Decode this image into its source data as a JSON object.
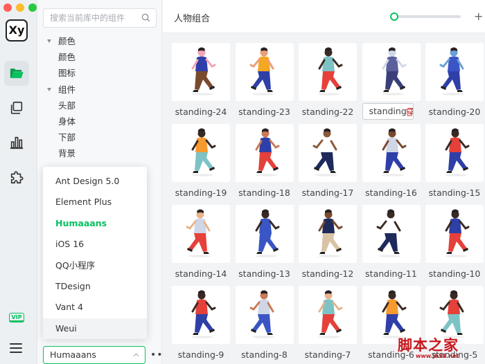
{
  "colors": {
    "accent": "#07c160",
    "traffic_red": "#ff5f57",
    "traffic_yellow": "#febc2e",
    "traffic_green": "#28c840",
    "watermark": "#c6171c"
  },
  "app": {
    "logo_text": "Xy"
  },
  "rail": {
    "items": [
      {
        "icon": "folder-open-icon",
        "active": true
      },
      {
        "icon": "copy-icon",
        "active": false
      },
      {
        "icon": "bar-chart-icon",
        "active": false
      },
      {
        "icon": "puzzle-icon",
        "active": false
      }
    ],
    "vip_label": "VIP",
    "menu_icon": "hamburger-menu-icon"
  },
  "sidebar": {
    "search_placeholder": "搜索当前库中的组件",
    "tree": [
      {
        "label": "颜色",
        "kind": "group"
      },
      {
        "label": "颜色",
        "kind": "leaf"
      },
      {
        "label": "图标",
        "kind": "leaf"
      },
      {
        "label": "组件",
        "kind": "group"
      },
      {
        "label": "头部",
        "kind": "leaf"
      },
      {
        "label": "身体",
        "kind": "leaf"
      },
      {
        "label": "下部",
        "kind": "leaf"
      },
      {
        "label": "背景",
        "kind": "leaf"
      }
    ],
    "library_select": "Humaaans",
    "more_label": "•••"
  },
  "dropdown": {
    "options": [
      "Ant Design 5.0",
      "Element Plus",
      "Humaaans",
      "iOS 16",
      "QQ小程序",
      "TDesign",
      "Vant 4",
      "Weui"
    ],
    "selected": "Humaaans",
    "hovered": "Weui"
  },
  "main": {
    "title": "人物组合",
    "zoom_slider_level": 0,
    "add_label": "+",
    "cards": [
      "standing-24",
      "standing-23",
      "standing-22",
      "standing-2",
      "standing-20",
      "standing-19",
      "standing-18",
      "standing-17",
      "standing-16",
      "standing-15",
      "standing-14",
      "standing-13",
      "standing-12",
      "standing-11",
      "standing-10",
      "standing-9",
      "standing-8",
      "standing-7",
      "standing-6",
      "standing-5"
    ],
    "editing_card": "standing-2"
  },
  "watermark": {
    "line1": "脚本之家",
    "line2": "www.jb51.net"
  }
}
